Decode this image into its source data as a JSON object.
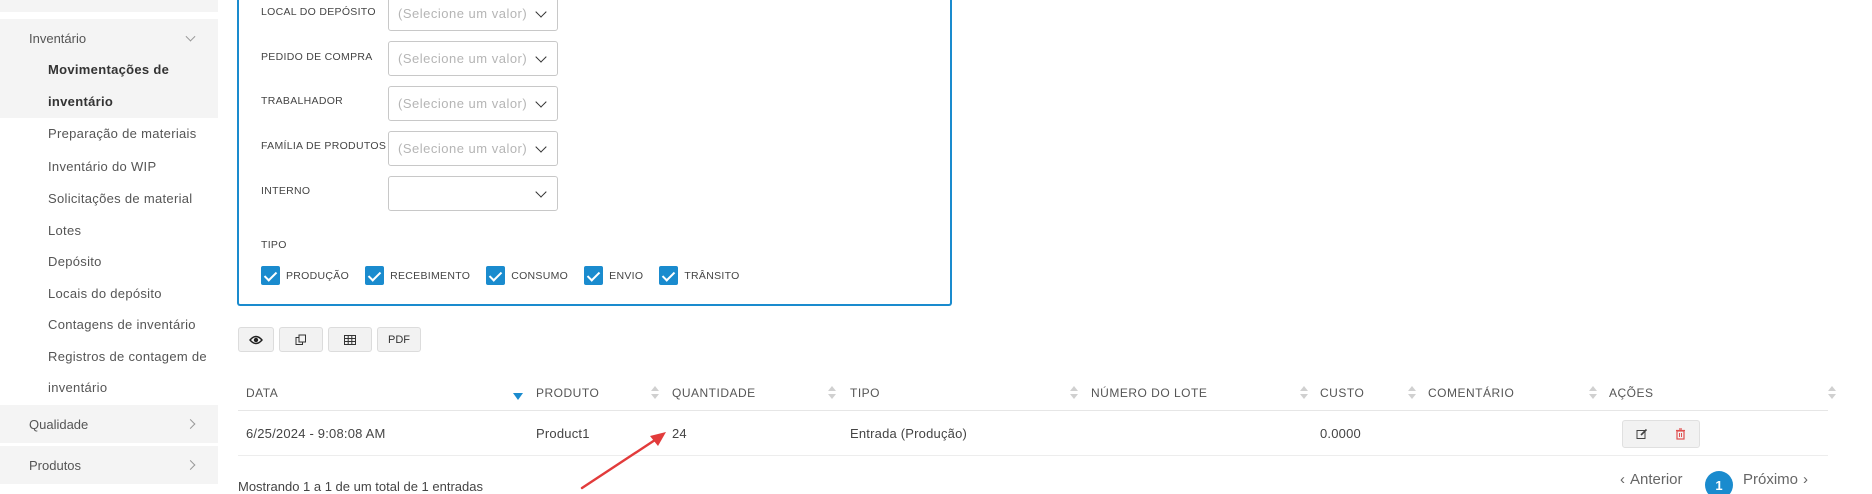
{
  "sidebar": {
    "groups": [
      {
        "label": "Inventário",
        "expanded": true
      },
      {
        "label": "Qualidade",
        "expanded": false
      },
      {
        "label": "Produtos",
        "expanded": false
      }
    ],
    "active_item_line1": "Movimentações de",
    "active_item_line2": "inventário",
    "items": [
      "Preparação de materiais",
      "Inventário do WIP",
      "Solicitações de material",
      "Lotes",
      "Depósito",
      "Locais do depósito",
      "Contagens de inventário",
      "Registros de contagem de",
      "inventário"
    ]
  },
  "filters": {
    "fields": [
      {
        "label": "LOCAL DO DEPÓSITO",
        "placeholder": "(Selecione um valor)"
      },
      {
        "label": "PEDIDO DE COMPRA",
        "placeholder": "(Selecione um valor)"
      },
      {
        "label": "TRABALHADOR",
        "placeholder": "(Selecione um valor)"
      },
      {
        "label": "FAMÍLIA DE PRODUTOS",
        "placeholder": "(Selecione um valor)"
      },
      {
        "label": "INTERNO",
        "placeholder": ""
      }
    ],
    "tipo_label": "TIPO",
    "tipo_options": [
      {
        "label": "PRODUÇÃO",
        "checked": true
      },
      {
        "label": "RECEBIMENTO",
        "checked": true
      },
      {
        "label": "CONSUMO",
        "checked": true
      },
      {
        "label": "ENVIO",
        "checked": true
      },
      {
        "label": "TRÂNSITO",
        "checked": true
      }
    ]
  },
  "toolbar": {
    "view_icon": "eye-icon",
    "copy_icon": "copy-icon",
    "columns_icon": "table-icon",
    "pdf_label": "PDF"
  },
  "table": {
    "columns": [
      "DATA",
      "PRODUTO",
      "QUANTIDADE",
      "TIPO",
      "NÚMERO DO LOTE",
      "CUSTO",
      "COMENTÁRIO",
      "AÇÕES"
    ],
    "rows": [
      {
        "data": "6/25/2024 - 9:08:08 AM",
        "produto": "Product1",
        "quantidade": "24",
        "tipo": "Entrada (Produção)",
        "lote": "",
        "custo": "0.0000",
        "comentario": ""
      }
    ]
  },
  "footer": {
    "info": "Mostrando 1 a 1 de um total de 1 entradas",
    "prev_label": "Anterior",
    "current_page": "1",
    "next_label": "Próximo"
  },
  "colors": {
    "accent": "#1a8bce",
    "annotation_arrow": "#e23b3b",
    "delete_icon": "#e05050"
  }
}
